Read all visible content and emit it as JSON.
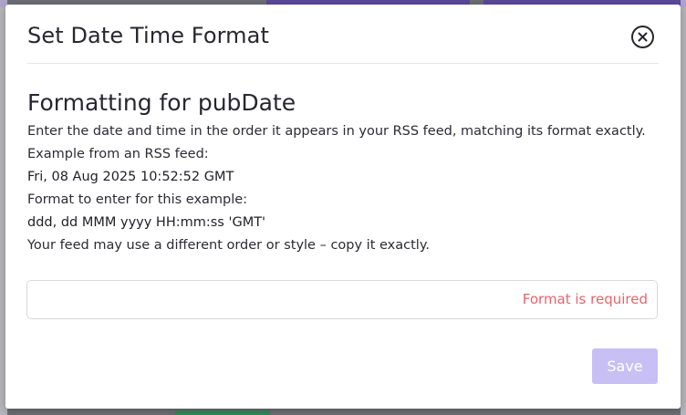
{
  "modal": {
    "title": "Set Date Time Format",
    "close_icon": "close-circle-icon"
  },
  "content": {
    "heading": "Formatting for pubDate",
    "instruction": "Enter the date and time in the order it appears in your RSS feed, matching its format exactly.",
    "example_label": "Example from an RSS feed:",
    "example_value": "Fri, 08 Aug 2025 10:52:52 GMT",
    "format_label": "Format to enter for this example:",
    "format_value": "ddd, dd MMM yyyy HH:mm:ss 'GMT'",
    "note": "Your feed may use a different order or style – copy it exactly."
  },
  "form": {
    "format_input_value": "",
    "error": "Format is required",
    "save_label": "Save"
  },
  "colors": {
    "error": "#e4656c",
    "save_disabled": "#c8c0f4",
    "text": "#27272f"
  }
}
